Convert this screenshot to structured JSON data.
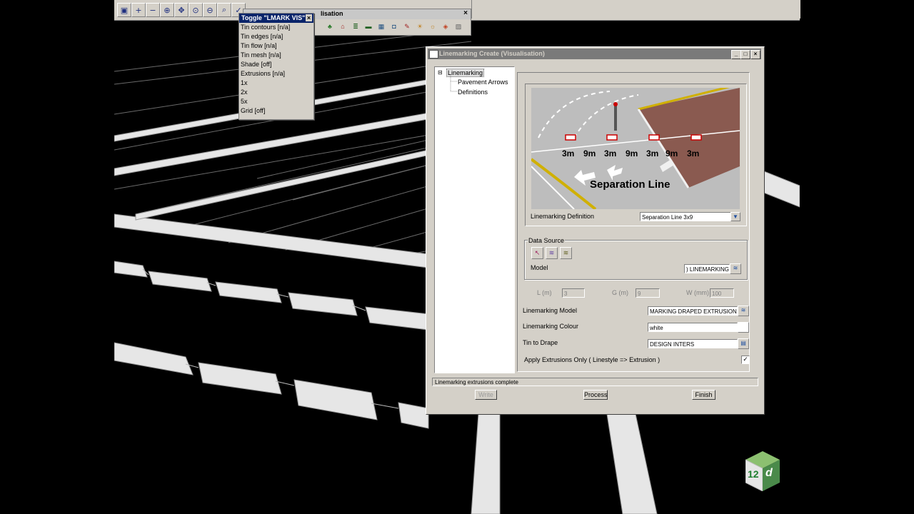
{
  "toggle_menu": {
    "title": "Toggle \"LMARK VIS\"",
    "items": [
      "Tin contours [n/a]",
      "Tin edges [n/a]",
      "Tin flow [n/a]",
      "Tin mesh [n/a]",
      "Shade [off]",
      "Extrusions [n/a]",
      "1x",
      "2x",
      "5x",
      "Grid [off]"
    ]
  },
  "vis_toolbar": {
    "title": "lisation"
  },
  "dialog": {
    "title": "Linemarking Create (Visualisation)",
    "tree": {
      "root": "Linemarking",
      "children": [
        "Pavement Arrows",
        "Definitions"
      ]
    },
    "preview": {
      "lengths": [
        "3m",
        "9m",
        "3m",
        "9m",
        "3m",
        "9m",
        "3m"
      ],
      "caption": "Separation Line"
    },
    "definition_label": "Linemarking Definition",
    "definition_value": "Separation Line 3x9",
    "data_source_legend": "Data  Source",
    "model_label": "Model",
    "model_value": ") LINEMARKING",
    "l_label": "L (m)",
    "l_value": "3",
    "g_label": "G (m)",
    "g_value": "9",
    "w_label": "W (mm)",
    "w_value": "100",
    "lm_model_label": "Linemarking Model",
    "lm_model_value": "MARKING DRAPED EXTRUSIONS",
    "lm_colour_label": "Linemarking Colour",
    "lm_colour_value": "white",
    "tin_label": "Tin to Drape",
    "tin_value": "DESIGN INTERS",
    "apply_label": "Apply Extrusions Only ( Linestyle => Extrusion )",
    "apply_checked": "✓",
    "status": "Linemarking extrusions complete",
    "buttons": {
      "write": "Write",
      "process": "Process",
      "finish": "Finish"
    }
  },
  "logo": {
    "text": "12",
    "sub": "d"
  },
  "colors": {
    "title_active": "#0a246a",
    "title_inactive": "#7a7a7a",
    "face": "#d4d0c8"
  }
}
